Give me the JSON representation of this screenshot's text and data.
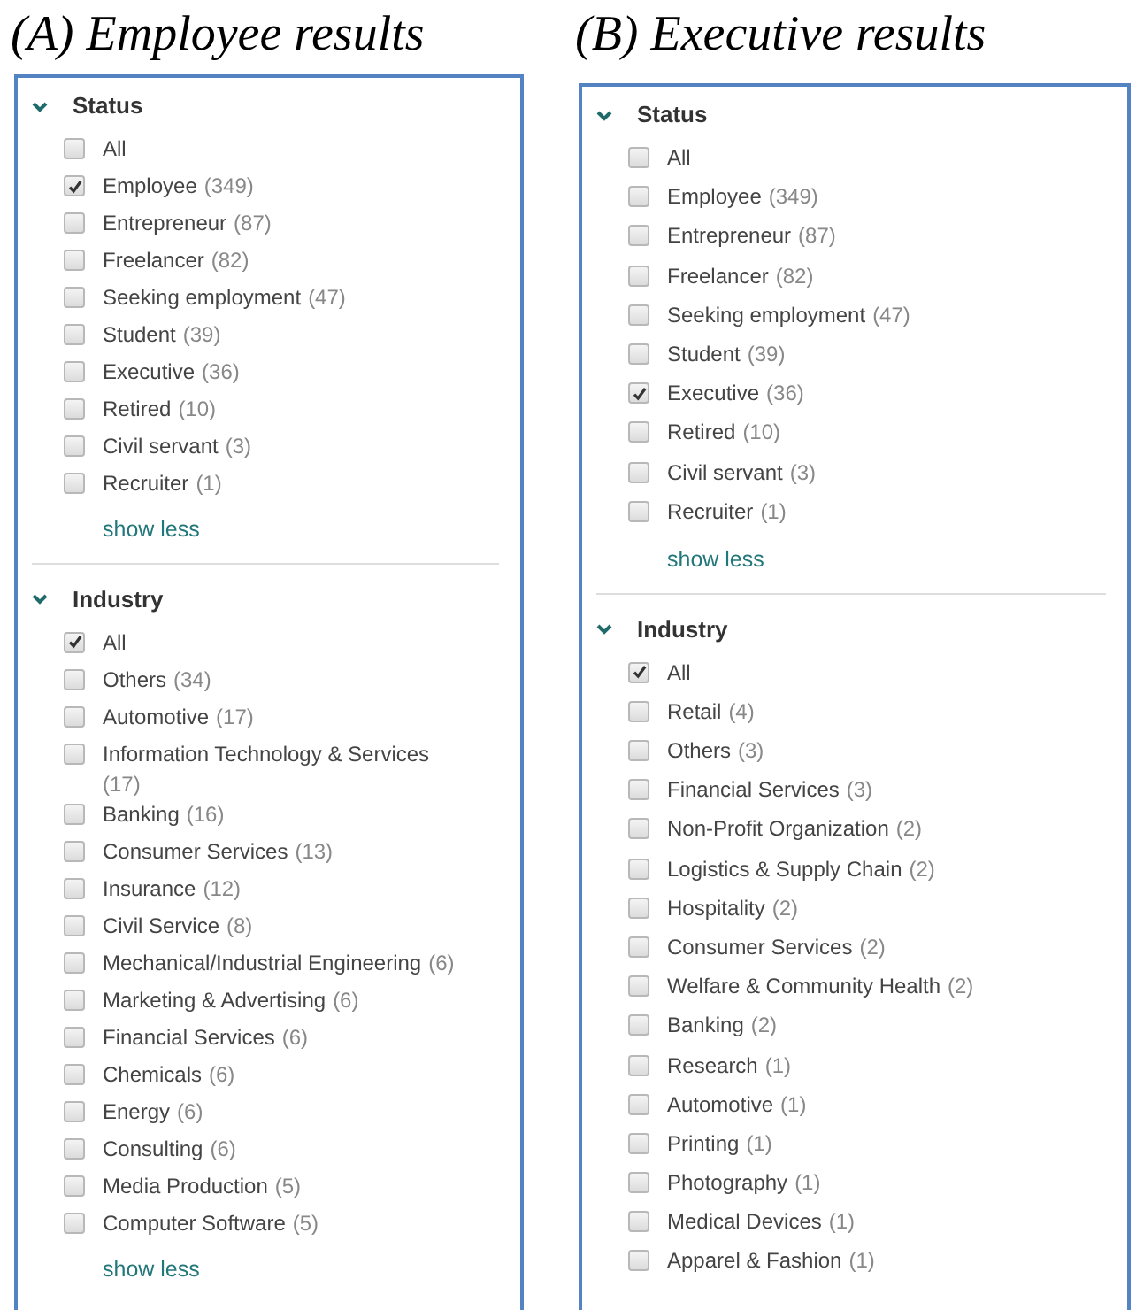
{
  "panels": [
    {
      "caption": "(A) Employee results",
      "sections": [
        {
          "title": "Status",
          "expanded": true,
          "show_less": "show less",
          "options": [
            {
              "label": "All",
              "checked": false
            },
            {
              "label": "Employee",
              "count": "(349)",
              "checked": true
            },
            {
              "label": "Entrepreneur",
              "count": "(87)",
              "checked": false
            },
            {
              "label": "Freelancer",
              "count": "(82)",
              "checked": false
            },
            {
              "label": "Seeking employment",
              "count": "(47)",
              "checked": false
            },
            {
              "label": "Student",
              "count": "(39)",
              "checked": false
            },
            {
              "label": "Executive",
              "count": "(36)",
              "checked": false
            },
            {
              "label": "Retired",
              "count": "(10)",
              "checked": false
            },
            {
              "label": "Civil servant",
              "count": "(3)",
              "checked": false
            },
            {
              "label": "Recruiter",
              "count": "(1)",
              "checked": false
            }
          ]
        },
        {
          "title": "Industry",
          "expanded": true,
          "show_less": "show less",
          "options": [
            {
              "label": "All",
              "checked": true
            },
            {
              "label": "Others",
              "count": "(34)",
              "checked": false
            },
            {
              "label": "Automotive",
              "count": "(17)",
              "checked": false
            },
            {
              "label": "Information Technology & Services",
              "count": "(17)",
              "checked": false
            },
            {
              "label": "Banking",
              "count": "(16)",
              "checked": false
            },
            {
              "label": "Consumer Services",
              "count": "(13)",
              "checked": false
            },
            {
              "label": "Insurance",
              "count": "(12)",
              "checked": false
            },
            {
              "label": "Civil Service",
              "count": "(8)",
              "checked": false
            },
            {
              "label": "Mechanical/Industrial Engineering",
              "count": "(6)",
              "checked": false
            },
            {
              "label": "Marketing & Advertising",
              "count": "(6)",
              "checked": false
            },
            {
              "label": "Financial Services",
              "count": "(6)",
              "checked": false
            },
            {
              "label": "Chemicals",
              "count": "(6)",
              "checked": false
            },
            {
              "label": "Energy",
              "count": "(6)",
              "checked": false
            },
            {
              "label": "Consulting",
              "count": "(6)",
              "checked": false
            },
            {
              "label": "Media Production",
              "count": "(5)",
              "checked": false
            },
            {
              "label": "Computer Software",
              "count": "(5)",
              "checked": false
            }
          ]
        }
      ]
    },
    {
      "caption": "(B) Executive results",
      "sections": [
        {
          "title": "Status",
          "expanded": true,
          "show_less": "show less",
          "options": [
            {
              "label": "All",
              "checked": false
            },
            {
              "label": "Employee",
              "count": "(349)",
              "checked": false
            },
            {
              "label": "Entrepreneur",
              "count": "(87)",
              "checked": false
            },
            {
              "label": "Freelancer",
              "count": "(82)",
              "checked": false
            },
            {
              "label": "Seeking employment",
              "count": "(47)",
              "checked": false
            },
            {
              "label": "Student",
              "count": "(39)",
              "checked": false
            },
            {
              "label": "Executive",
              "count": "(36)",
              "checked": true
            },
            {
              "label": "Retired",
              "count": "(10)",
              "checked": false
            },
            {
              "label": "Civil servant",
              "count": "(3)",
              "checked": false
            },
            {
              "label": "Recruiter",
              "count": "(1)",
              "checked": false
            }
          ]
        },
        {
          "title": "Industry",
          "expanded": true,
          "options": [
            {
              "label": "All",
              "checked": true
            },
            {
              "label": "Retail",
              "count": "(4)",
              "checked": false
            },
            {
              "label": "Others",
              "count": "(3)",
              "checked": false
            },
            {
              "label": "Financial Services",
              "count": "(3)",
              "checked": false
            },
            {
              "label": "Non-Profit Organization",
              "count": "(2)",
              "checked": false
            },
            {
              "label": "Logistics & Supply Chain",
              "count": "(2)",
              "checked": false
            },
            {
              "label": "Hospitality",
              "count": "(2)",
              "checked": false
            },
            {
              "label": "Consumer Services",
              "count": "(2)",
              "checked": false
            },
            {
              "label": "Welfare & Community Health",
              "count": "(2)",
              "checked": false
            },
            {
              "label": "Banking",
              "count": "(2)",
              "checked": false
            },
            {
              "label": "Research",
              "count": "(1)",
              "checked": false
            },
            {
              "label": "Automotive",
              "count": "(1)",
              "checked": false
            },
            {
              "label": "Printing",
              "count": "(1)",
              "checked": false
            },
            {
              "label": "Photography",
              "count": "(1)",
              "checked": false
            },
            {
              "label": "Medical Devices",
              "count": "(1)",
              "checked": false
            },
            {
              "label": "Apparel & Fashion",
              "count": "(1)",
              "checked": false
            }
          ]
        }
      ]
    }
  ]
}
